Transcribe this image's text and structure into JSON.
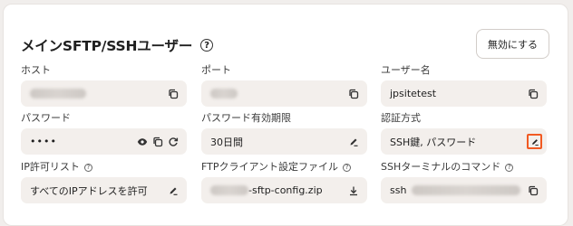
{
  "header": {
    "title": "メインSFTP/SSHユーザー",
    "help": "?",
    "disable_button": "無効にする"
  },
  "fields": {
    "host": {
      "label": "ホスト",
      "value": ""
    },
    "port": {
      "label": "ポート",
      "value": ""
    },
    "username": {
      "label": "ユーザー名",
      "value": "jpsitetest"
    },
    "password": {
      "label": "パスワード",
      "value": "••••"
    },
    "password_expiry": {
      "label": "パスワード有効期限",
      "value": "30日間"
    },
    "auth_method": {
      "label": "認証方式",
      "value": "SSH鍵, パスワード"
    },
    "ip_allowlist": {
      "label": "IP許可リスト",
      "help": "?",
      "value": "すべてのIPアドレスを許可"
    },
    "ftp_config": {
      "label": "FTPクライアント設定ファイル",
      "help": "?",
      "value": "-sftp-config.zip"
    },
    "ssh_command": {
      "label": "SSHターミナルのコマンド",
      "help": "?",
      "value": "ssh"
    }
  },
  "colors": {
    "accent_highlight": "#f15a22",
    "field_bg": "#f3efec"
  },
  "icons": [
    "help-icon",
    "copy-icon",
    "eye-icon",
    "refresh-icon",
    "edit-icon",
    "download-icon"
  ]
}
